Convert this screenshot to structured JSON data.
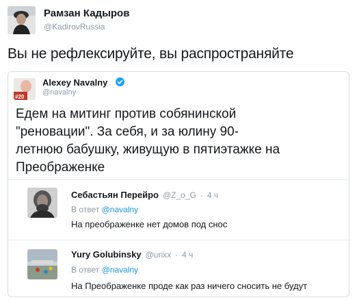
{
  "outer_tweet": {
    "author_name": "Рамзан Кадыров",
    "author_handle": "@KadirovRussia",
    "text": "Вы не рефлексируйте, вы распространяйте"
  },
  "quoted_tweet": {
    "author_name": "Alexey Navalny",
    "author_handle": "@navalny",
    "avatar_badge": "#20",
    "text_lines": [
      "Едем на митинг против собянинской",
      "\"реновации\". За себя, и за юлину 90-",
      "летнюю бабушку, живущую в пятиэтажке на",
      "Преображенке"
    ]
  },
  "replies": [
    {
      "author_name": "Себастьян Перейро",
      "author_handle": "@Z_o_G",
      "separator": "·",
      "time": "4 ч",
      "reply_prefix": "В ответ",
      "reply_to": "@navalny",
      "text": "На преображенке нет домов под снос"
    },
    {
      "author_name": "Yury Golubinsky",
      "author_handle": "@urixx",
      "separator": "·",
      "time": "4 ч",
      "reply_prefix": "В ответ",
      "reply_to": "@navalny",
      "text": "На Преображенке проде как раз ничего сносить не будут"
    }
  ],
  "colors": {
    "link": "#1b95e0",
    "muted": "#8a99a6",
    "text": "#14171a",
    "border": "#d6dde3",
    "verified": "#1da1f2"
  }
}
